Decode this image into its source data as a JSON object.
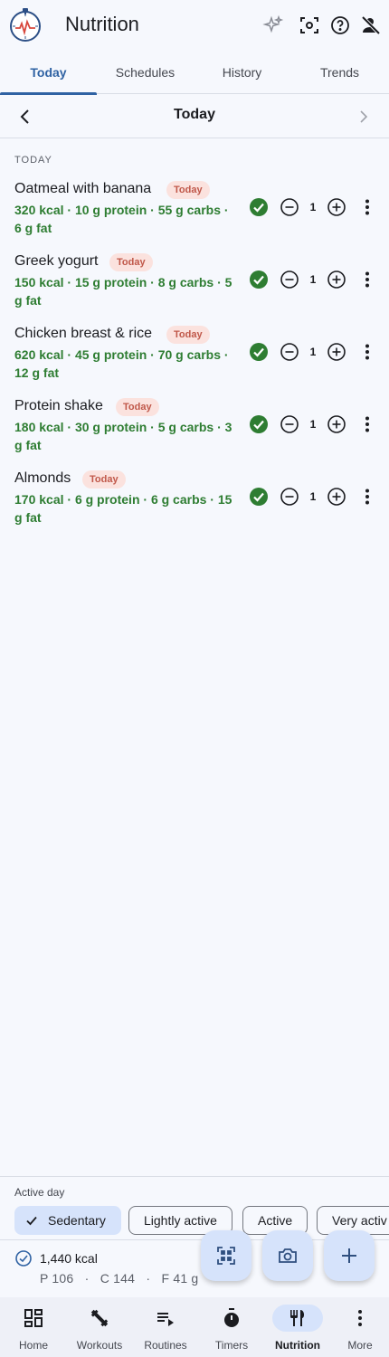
{
  "app": {
    "title": "Nutrition"
  },
  "tabs": [
    {
      "label": "Today",
      "active": true
    },
    {
      "label": "Schedules",
      "active": false
    },
    {
      "label": "History",
      "active": false
    },
    {
      "label": "Trends",
      "active": false
    }
  ],
  "day_nav": {
    "title": "Today"
  },
  "section": {
    "label": "TODAY"
  },
  "meals": [
    {
      "name": "Oatmeal with banana",
      "badge": "Today",
      "macros": "320 kcal · 10 g protein · 55 g carbs · 6 g fat",
      "quantity": "1"
    },
    {
      "name": "Greek yogurt",
      "badge": "Today",
      "macros": "150 kcal · 15 g protein · 8 g carbs · 5 g fat",
      "quantity": "1"
    },
    {
      "name": "Chicken breast & rice",
      "badge": "Today",
      "macros": "620 kcal · 45 g protein · 70 g carbs · 12 g fat",
      "quantity": "1"
    },
    {
      "name": "Protein shake",
      "badge": "Today",
      "macros": "180 kcal · 30 g protein · 5 g carbs · 3 g fat",
      "quantity": "1"
    },
    {
      "name": "Almonds",
      "badge": "Today",
      "macros": "170 kcal · 6 g protein · 6 g carbs · 15 g fat",
      "quantity": "1"
    }
  ],
  "activity": {
    "label": "Active day",
    "options": [
      "Sedentary",
      "Lightly active",
      "Active",
      "Very activ"
    ],
    "selected": "Sedentary"
  },
  "summary": {
    "kcal": "1,440 kcal",
    "macros": "P 106   ·   C 144   ·   F 41 g"
  },
  "fabs": [
    "qr-scan-icon",
    "camera-icon",
    "add-icon"
  ],
  "bottom_nav": [
    {
      "label": "Home",
      "icon": "dashboard-icon",
      "active": false
    },
    {
      "label": "Workouts",
      "icon": "dumbbell-icon",
      "active": false
    },
    {
      "label": "Routines",
      "icon": "playlist-icon",
      "active": false
    },
    {
      "label": "Timers",
      "icon": "stopwatch-icon",
      "active": false
    },
    {
      "label": "Nutrition",
      "icon": "cutlery-icon",
      "active": true
    },
    {
      "label": "More",
      "icon": "more-vertical-icon",
      "active": false
    }
  ],
  "colors": {
    "accent": "#2f62a3",
    "macro_text": "#2e7d32",
    "badge_bg": "#fbe2de",
    "badge_text": "#c0584a",
    "check_green": "#2e7d32",
    "pill": "#d6e3fb"
  }
}
